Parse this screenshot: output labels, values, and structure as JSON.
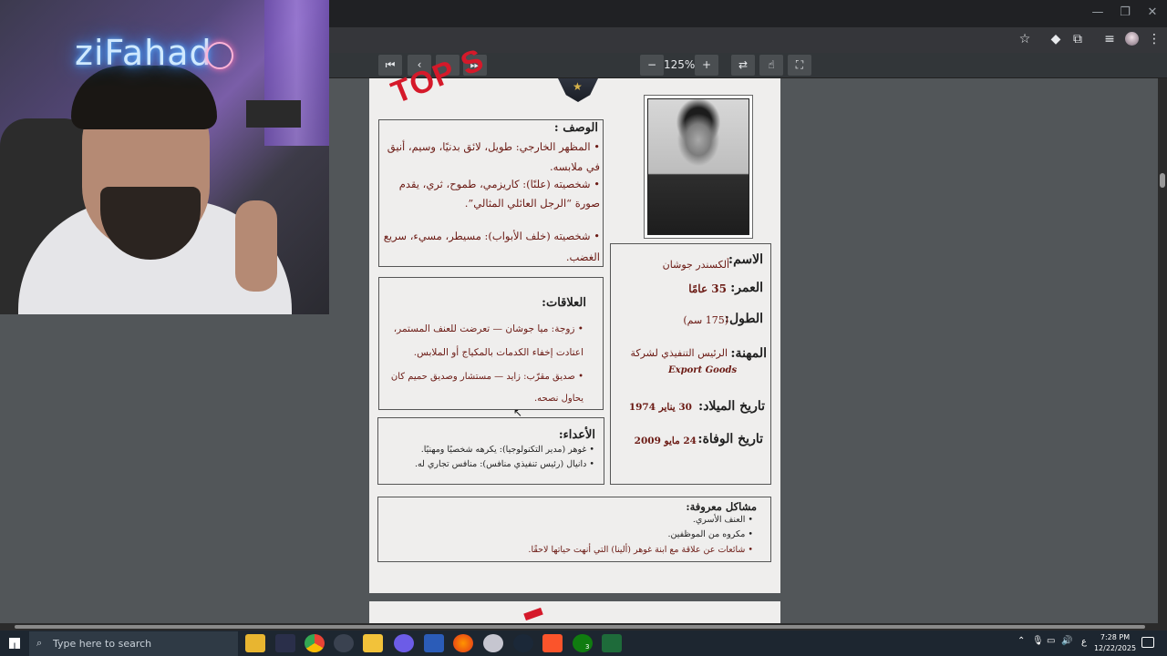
{
  "browser": {
    "window_controls": {
      "minimize": "—",
      "maximize": "❐",
      "close": "✕"
    },
    "icons": [
      "star-icon",
      "extension-diamond-icon",
      "puzzle-icon",
      "media-icon",
      "profile-icon",
      "menu-icon"
    ]
  },
  "pdf_toolbar": {
    "first_page": "⏮",
    "prev_page": "‹",
    "next_page": "›",
    "last_page": "⏭",
    "zoom_out": "−",
    "zoom_level": "125%",
    "zoom_in": "+",
    "rotate": "⇄",
    "touch": "☝",
    "fit": "⛶"
  },
  "webcam": {
    "neon_sign": "ziFahad"
  },
  "document": {
    "stamp": "TOP S",
    "description": {
      "title": "الوصف :",
      "line1": "• المظهر الخارجي: طويل، لائق بدنيًا، وسيم، أنيق",
      "line2": "في ملابسه.",
      "line3": "• شخصيته (علنًا): كاريزمي، طموح، ثري، يقدم",
      "line4": "صورة “الرجل العائلي المثالي”.",
      "line5": "• شخصيته (خلف الأبواب): مسيطر، مسيء، سريع",
      "line6": "الغضب."
    },
    "relations": {
      "title": "العلاقات:",
      "line1": "• زوجة: ميا جوشان — تعرضت للعنف المستمر،",
      "line2": "اعتادت إخفاء الكدمات بالمكياج أو الملابس.",
      "line3": "• صديق مقرّب: زايد — مستشار وصديق حميم كان",
      "line4": "يحاول نصحه."
    },
    "enemies": {
      "title": "الأعداء:",
      "line1": "• غوهر (مدير التكنولوجيا): يكرهه شخصيًا ومهنيًا.",
      "line2": "• دانيال (رئيس تنفيذي منافس): منافس تجاري له."
    },
    "profile": {
      "name_label": "الاسم:",
      "name_value": "ألكسندر جوشان",
      "age_label": "العمر:",
      "age_value": "35 عامًا",
      "height_label": "الطول:",
      "height_value": "(175 سم)",
      "job_label": "المهنة:",
      "job_value": "الرئيس التنفيذي لشركة",
      "job_company": "Export Goods",
      "birth_label": "تاريخ الميلاد:",
      "birth_value": "30 يناير 1974",
      "death_label": "تاريخ الوفاة:",
      "death_value": "24 مايو 2009"
    },
    "issues": {
      "title": "مشاكل معروفة:",
      "line1": "• العنف الأسري.",
      "line2": "• مكروه من الموظفين.",
      "line3": "• شائعات عن علاقة مع ابنة غوهر (ألينا) التي أنهت حياتها لاحقًا."
    }
  },
  "taskbar": {
    "search_placeholder": "Type here to search",
    "tray_lang": "ع",
    "time": "7:28 PM",
    "date": "12/22/2025",
    "xbox_badge": "3"
  }
}
